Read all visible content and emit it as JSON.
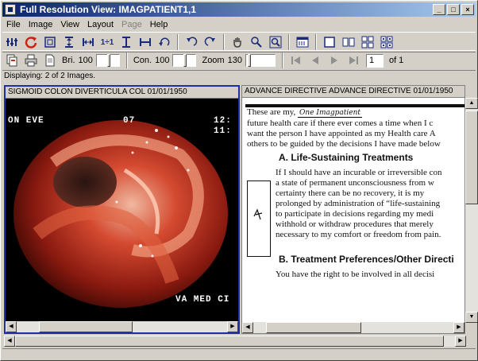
{
  "window": {
    "title": "Full Resolution View: IMAGPATIENT1,1"
  },
  "menu": [
    "File",
    "Image",
    "View",
    "Layout",
    "Page",
    "Help"
  ],
  "menu_disabled": [
    "Page"
  ],
  "toolbar2": {
    "bri_label": "Bri.",
    "bri_value": "100",
    "con_label": "Con.",
    "con_value": "100",
    "zoom_label": "Zoom",
    "zoom_value": "130",
    "page_value": "1",
    "page_of": "of 1"
  },
  "status_text": "Displaying: 2 of 2 Images.",
  "pane1": {
    "header": "SIGMOID COLON DIVERTICULA COL  01/01/1950",
    "overlay_top_left": "ON EVE",
    "overlay_top_mid": "07",
    "overlay_top_right": "12:",
    "overlay_top_right2": "11:",
    "overlay_bottom": "VA MED CI"
  },
  "pane2": {
    "header": "ADVANCE DIRECTIVE ADVANCE DIRECTIVE  01/01/1950",
    "handwriting": "One Imagpatient",
    "lines_intro": [
      "These are my,",
      "future health care if there ever comes a time when I c",
      "want the person I have appointed as my Health care A",
      "others to be guided by the decisions I have made below"
    ],
    "section_a": "A.   Life-Sustaining Treatments",
    "lines_a": [
      "If I should have an incurable or irreversible con",
      "a state of permanent unconsciousness from w",
      "certainty there can be no recovery, it is my",
      "prolonged by administration of “life-sustaining",
      "to participate in decisions regarding my medi",
      "withhold or withdraw procedures that merely",
      "necessary to my comfort or freedom from pain."
    ],
    "section_b": "B.   Treatment Preferences/Other Directi",
    "line_b": "You have the right to be involved in all decisi"
  },
  "colors": {
    "title_start": "#0a246a",
    "title_end": "#a6caf0",
    "active_border": "#2030a0"
  }
}
